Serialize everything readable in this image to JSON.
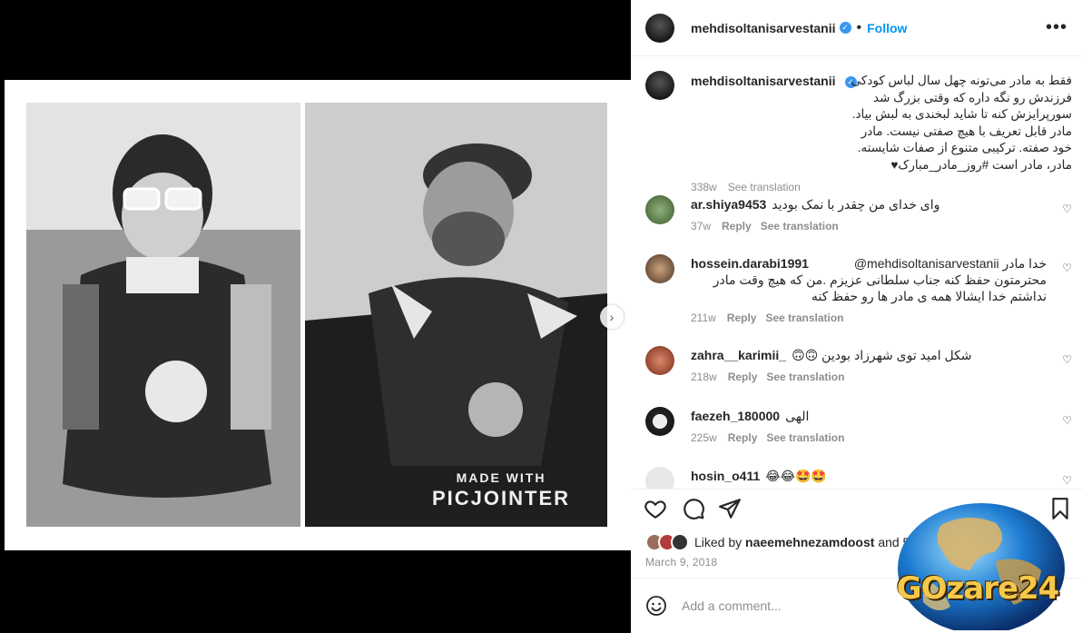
{
  "header": {
    "username": "mehdisoltanisarvestanii",
    "follow_label": "Follow",
    "dot": "•",
    "more_icon": "more-horizontal-icon"
  },
  "caption": {
    "username": "mehdisoltanisarvestanii",
    "text": "فقط به مادر می‌تونه چهل سال لباس کودکی فرزندش رو نگه داره که وقتی بزرگ شد سورپرایزش کنه تا شاید لبخندی به لبش بیاد. مادر قابل تعریف با هیچ صفتی نیست. مادر خود صفته. ترکیبی متنوع از صفات شایسته. مادر، مادر است #روز_مادر_مبارک♥",
    "time": "338w",
    "see_translation": "See translation"
  },
  "comments": [
    {
      "username": "ar.shiya9453",
      "text": "وای خدای من چقدر با نمک بودید",
      "time": "37w",
      "reply": "Reply",
      "see_translation": "See translation"
    },
    {
      "username": "hossein.darabi1991",
      "text": "@mehdisoltanisarvestanii خدا مادر محترمتون حفظ کنه جناب سلطانی عزیزم .من که هیچ وقت مادر نداشتم خدا ایشالا همه ی مادر ها رو حفظ کنه",
      "time": "211w",
      "reply": "Reply",
      "see_translation": "See translation"
    },
    {
      "username": "zahra__karimii_",
      "text": "شکل امید توی شهرزاد بودین 🙃🙃",
      "time": "218w",
      "reply": "Reply",
      "see_translation": "See translation"
    },
    {
      "username": "faezeh_180000",
      "text": "الهی",
      "time": "225w",
      "reply": "Reply",
      "see_translation": "See translation"
    },
    {
      "username": "hosin_o411",
      "text": "😂😂🤩🤩",
      "time": "",
      "reply": "",
      "see_translation": ""
    }
  ],
  "photo": {
    "watermark_line1": "MADE WITH",
    "watermark_line2": "PICJOINTER"
  },
  "actions": {
    "like_icon": "heart-icon",
    "comment_icon": "comment-icon",
    "share_icon": "share-icon",
    "save_icon": "bookmark-icon"
  },
  "likes": {
    "prefix": "Liked by",
    "user": "naeemehnezamdoost",
    "suffix": "and 5"
  },
  "date": "March 9, 2018",
  "comment_input": {
    "placeholder": "Add a comment..."
  },
  "logo": {
    "text": "GOzare24"
  },
  "colors": {
    "accent": "#0095f6",
    "verified": "#3897f0",
    "logo_gold": "#f5c84a"
  }
}
